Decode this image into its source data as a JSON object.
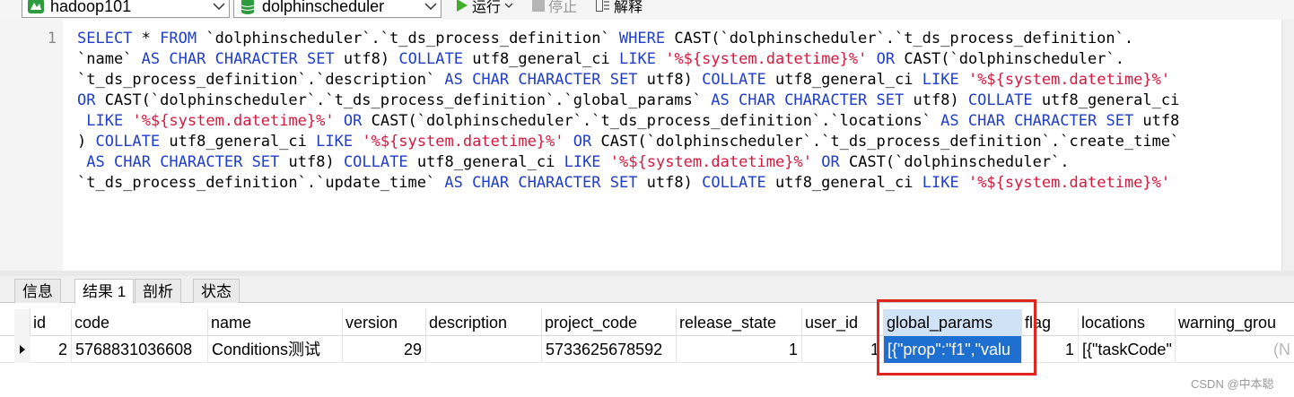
{
  "toolbar": {
    "connection": "hadoop101",
    "database": "dolphinscheduler",
    "run_label": "运行",
    "stop_label": "停止",
    "explain_label": "解释",
    "connection_color": "#2e9b3e",
    "database_color": "#2e9b3e",
    "run_color": "#3fae2a"
  },
  "editor": {
    "line_number": "1",
    "lines": [
      [
        [
          "kw",
          "SELECT"
        ],
        [
          "txt",
          " * "
        ],
        [
          "kw",
          "FROM"
        ],
        [
          "txt",
          " `dolphinscheduler`.`t_ds_process_definition` "
        ],
        [
          "kw",
          "WHERE"
        ],
        [
          "txt",
          " CAST(`dolphinscheduler`.`t_ds_process_definition`."
        ]
      ],
      [
        [
          "txt",
          "`name` "
        ],
        [
          "kw",
          "AS"
        ],
        [
          "txt",
          " "
        ],
        [
          "kw",
          "CHAR"
        ],
        [
          "txt",
          " "
        ],
        [
          "kw",
          "CHARACTER"
        ],
        [
          "txt",
          " "
        ],
        [
          "kw",
          "SET"
        ],
        [
          "txt",
          " utf8) "
        ],
        [
          "kw",
          "COLLATE"
        ],
        [
          "txt",
          " utf8_general_ci "
        ],
        [
          "kw",
          "LIKE"
        ],
        [
          "txt",
          " "
        ],
        [
          "str",
          "'%${system.datetime}%'"
        ],
        [
          "txt",
          " "
        ],
        [
          "kw",
          "OR"
        ],
        [
          "txt",
          " CAST(`dolphinscheduler`."
        ]
      ],
      [
        [
          "txt",
          "`t_ds_process_definition`.`description` "
        ],
        [
          "kw",
          "AS"
        ],
        [
          "txt",
          " "
        ],
        [
          "kw",
          "CHAR"
        ],
        [
          "txt",
          " "
        ],
        [
          "kw",
          "CHARACTER"
        ],
        [
          "txt",
          " "
        ],
        [
          "kw",
          "SET"
        ],
        [
          "txt",
          " utf8) "
        ],
        [
          "kw",
          "COLLATE"
        ],
        [
          "txt",
          " utf8_general_ci "
        ],
        [
          "kw",
          "LIKE"
        ],
        [
          "txt",
          " "
        ],
        [
          "str",
          "'%${system.datetime}%'"
        ]
      ],
      [
        [
          "kw",
          "OR"
        ],
        [
          "txt",
          " CAST(`dolphinscheduler`.`t_ds_process_definition`.`global_params` "
        ],
        [
          "kw",
          "AS"
        ],
        [
          "txt",
          " "
        ],
        [
          "kw",
          "CHAR"
        ],
        [
          "txt",
          " "
        ],
        [
          "kw",
          "CHARACTER"
        ],
        [
          "txt",
          " "
        ],
        [
          "kw",
          "SET"
        ],
        [
          "txt",
          " utf8) "
        ],
        [
          "kw",
          "COLLATE"
        ],
        [
          "txt",
          " utf8_general_ci"
        ]
      ],
      [
        [
          "txt",
          " "
        ],
        [
          "kw",
          "LIKE"
        ],
        [
          "txt",
          " "
        ],
        [
          "str",
          "'%${system.datetime}%'"
        ],
        [
          "txt",
          " "
        ],
        [
          "kw",
          "OR"
        ],
        [
          "txt",
          " CAST(`dolphinscheduler`.`t_ds_process_definition`.`locations` "
        ],
        [
          "kw",
          "AS"
        ],
        [
          "txt",
          " "
        ],
        [
          "kw",
          "CHAR"
        ],
        [
          "txt",
          " "
        ],
        [
          "kw",
          "CHARACTER"
        ],
        [
          "txt",
          " "
        ],
        [
          "kw",
          "SET"
        ],
        [
          "txt",
          " utf8"
        ]
      ],
      [
        [
          "txt",
          ") "
        ],
        [
          "kw",
          "COLLATE"
        ],
        [
          "txt",
          " utf8_general_ci "
        ],
        [
          "kw",
          "LIKE"
        ],
        [
          "txt",
          " "
        ],
        [
          "str",
          "'%${system.datetime}%'"
        ],
        [
          "txt",
          " "
        ],
        [
          "kw",
          "OR"
        ],
        [
          "txt",
          " CAST(`dolphinscheduler`.`t_ds_process_definition`.`create_time`"
        ]
      ],
      [
        [
          "txt",
          " "
        ],
        [
          "kw",
          "AS"
        ],
        [
          "txt",
          " "
        ],
        [
          "kw",
          "CHAR"
        ],
        [
          "txt",
          " "
        ],
        [
          "kw",
          "CHARACTER"
        ],
        [
          "txt",
          " "
        ],
        [
          "kw",
          "SET"
        ],
        [
          "txt",
          " utf8) "
        ],
        [
          "kw",
          "COLLATE"
        ],
        [
          "txt",
          " utf8_general_ci "
        ],
        [
          "kw",
          "LIKE"
        ],
        [
          "txt",
          " "
        ],
        [
          "str",
          "'%${system.datetime}%'"
        ],
        [
          "txt",
          " "
        ],
        [
          "kw",
          "OR"
        ],
        [
          "txt",
          " CAST(`dolphinscheduler`."
        ]
      ],
      [
        [
          "txt",
          "`t_ds_process_definition`.`update_time` "
        ],
        [
          "kw",
          "AS"
        ],
        [
          "txt",
          " "
        ],
        [
          "kw",
          "CHAR"
        ],
        [
          "txt",
          " "
        ],
        [
          "kw",
          "CHARACTER"
        ],
        [
          "txt",
          " "
        ],
        [
          "kw",
          "SET"
        ],
        [
          "txt",
          " utf8) "
        ],
        [
          "kw",
          "COLLATE"
        ],
        [
          "txt",
          " utf8_general_ci "
        ],
        [
          "kw",
          "LIKE"
        ],
        [
          "txt",
          " "
        ],
        [
          "str",
          "'%${system.datetime}%'"
        ]
      ]
    ],
    "keyword_color": "#1f3ec9",
    "string_color": "#d4183d"
  },
  "tabs": [
    {
      "label": "信息",
      "active": false
    },
    {
      "label": "结果 1",
      "active": true
    },
    {
      "label": "剖析",
      "active": false
    },
    {
      "label": "状态",
      "active": false
    }
  ],
  "grid": {
    "columns": [
      "id",
      "code",
      "name",
      "version",
      "description",
      "project_code",
      "release_state",
      "user_id",
      "global_params",
      "flag",
      "locations",
      "warning_grou"
    ],
    "rows": [
      [
        "2",
        "5768831036608",
        "Conditions测试",
        "29",
        "",
        "5733625678592",
        "1",
        "1",
        "[{\"prop\":\"f1\",\"valu",
        "1",
        "[{\"taskCode\"",
        "(N"
      ]
    ],
    "selected_column": "global_params",
    "selection_color": "#1f6fd1",
    "highlight_color": "#e0251f"
  },
  "watermark": "CSDN @中本聪"
}
